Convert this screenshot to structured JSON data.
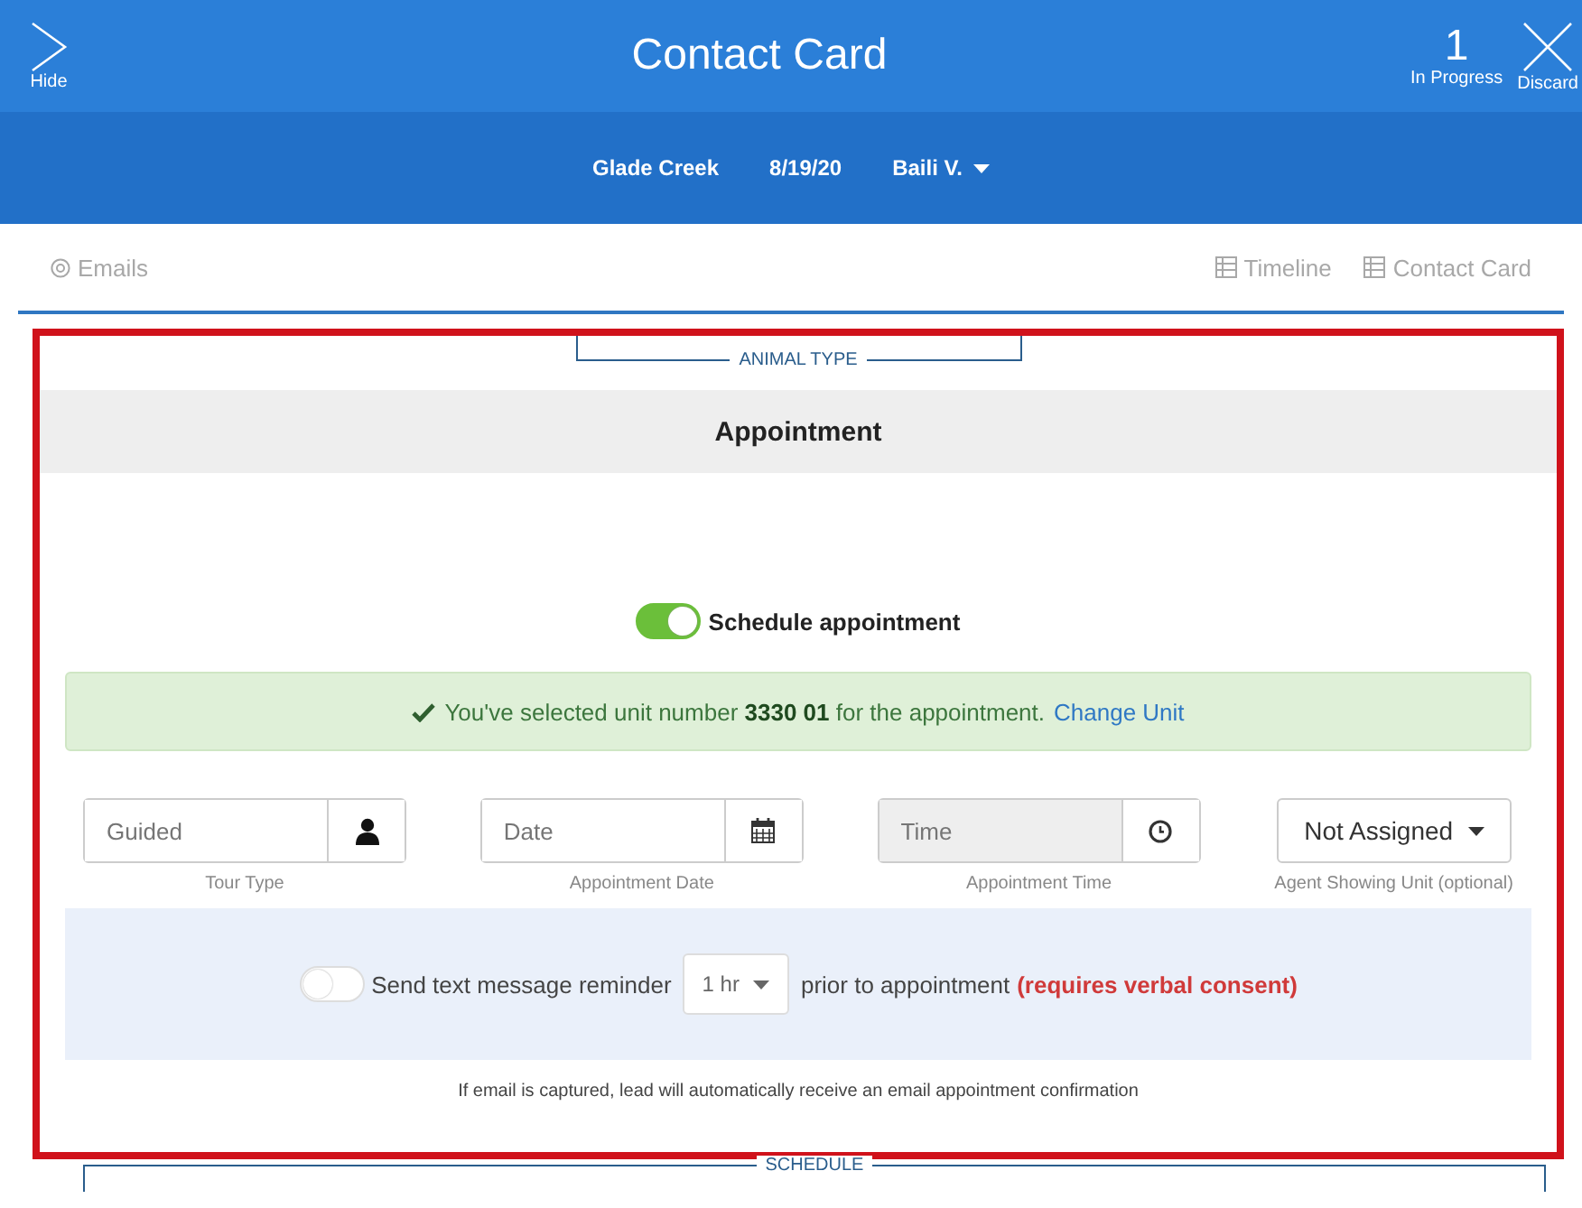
{
  "header": {
    "hide_label": "Hide",
    "title": "Contact Card",
    "in_progress_count": "1",
    "in_progress_label": "In Progress",
    "discard_label": "Discard"
  },
  "subheader": {
    "community": "Glade Creek",
    "date": "8/19/20",
    "agent": "Baili V."
  },
  "nav": {
    "left": [
      {
        "label": "Emails"
      }
    ],
    "right": [
      {
        "label": "Timeline"
      },
      {
        "label": "Contact Card"
      }
    ]
  },
  "section_above": {
    "label": "ANIMAL TYPE"
  },
  "appointment": {
    "title": "Appointment",
    "schedule_toggle": {
      "label": "Schedule appointment",
      "on": true
    },
    "alert": {
      "text": "You've selected unit number **3330 01** for the appointment.",
      "link": "Change Unit"
    },
    "fields": [
      {
        "kind": "input",
        "placeholder": "Guided",
        "caption": "Tour Type",
        "disabled": false
      },
      {
        "kind": "input",
        "placeholder": "Date",
        "caption": "Appointment Date",
        "disabled": false
      },
      {
        "kind": "input",
        "placeholder": "Time",
        "caption": "Appointment Time",
        "disabled": true
      },
      {
        "kind": "dropdown",
        "value": "Not Assigned",
        "caption": "Agent Showing Unit (optional)"
      }
    ],
    "reminder": {
      "on": false,
      "label": "Send text message reminder",
      "interval": "1 hr",
      "suffix": "prior to appointment",
      "warning": "(requires verbal consent)"
    },
    "note": "If email is captured, lead will automatically receive an email appointment confirmation"
  },
  "section_below": {
    "label": "SCHEDULE"
  }
}
